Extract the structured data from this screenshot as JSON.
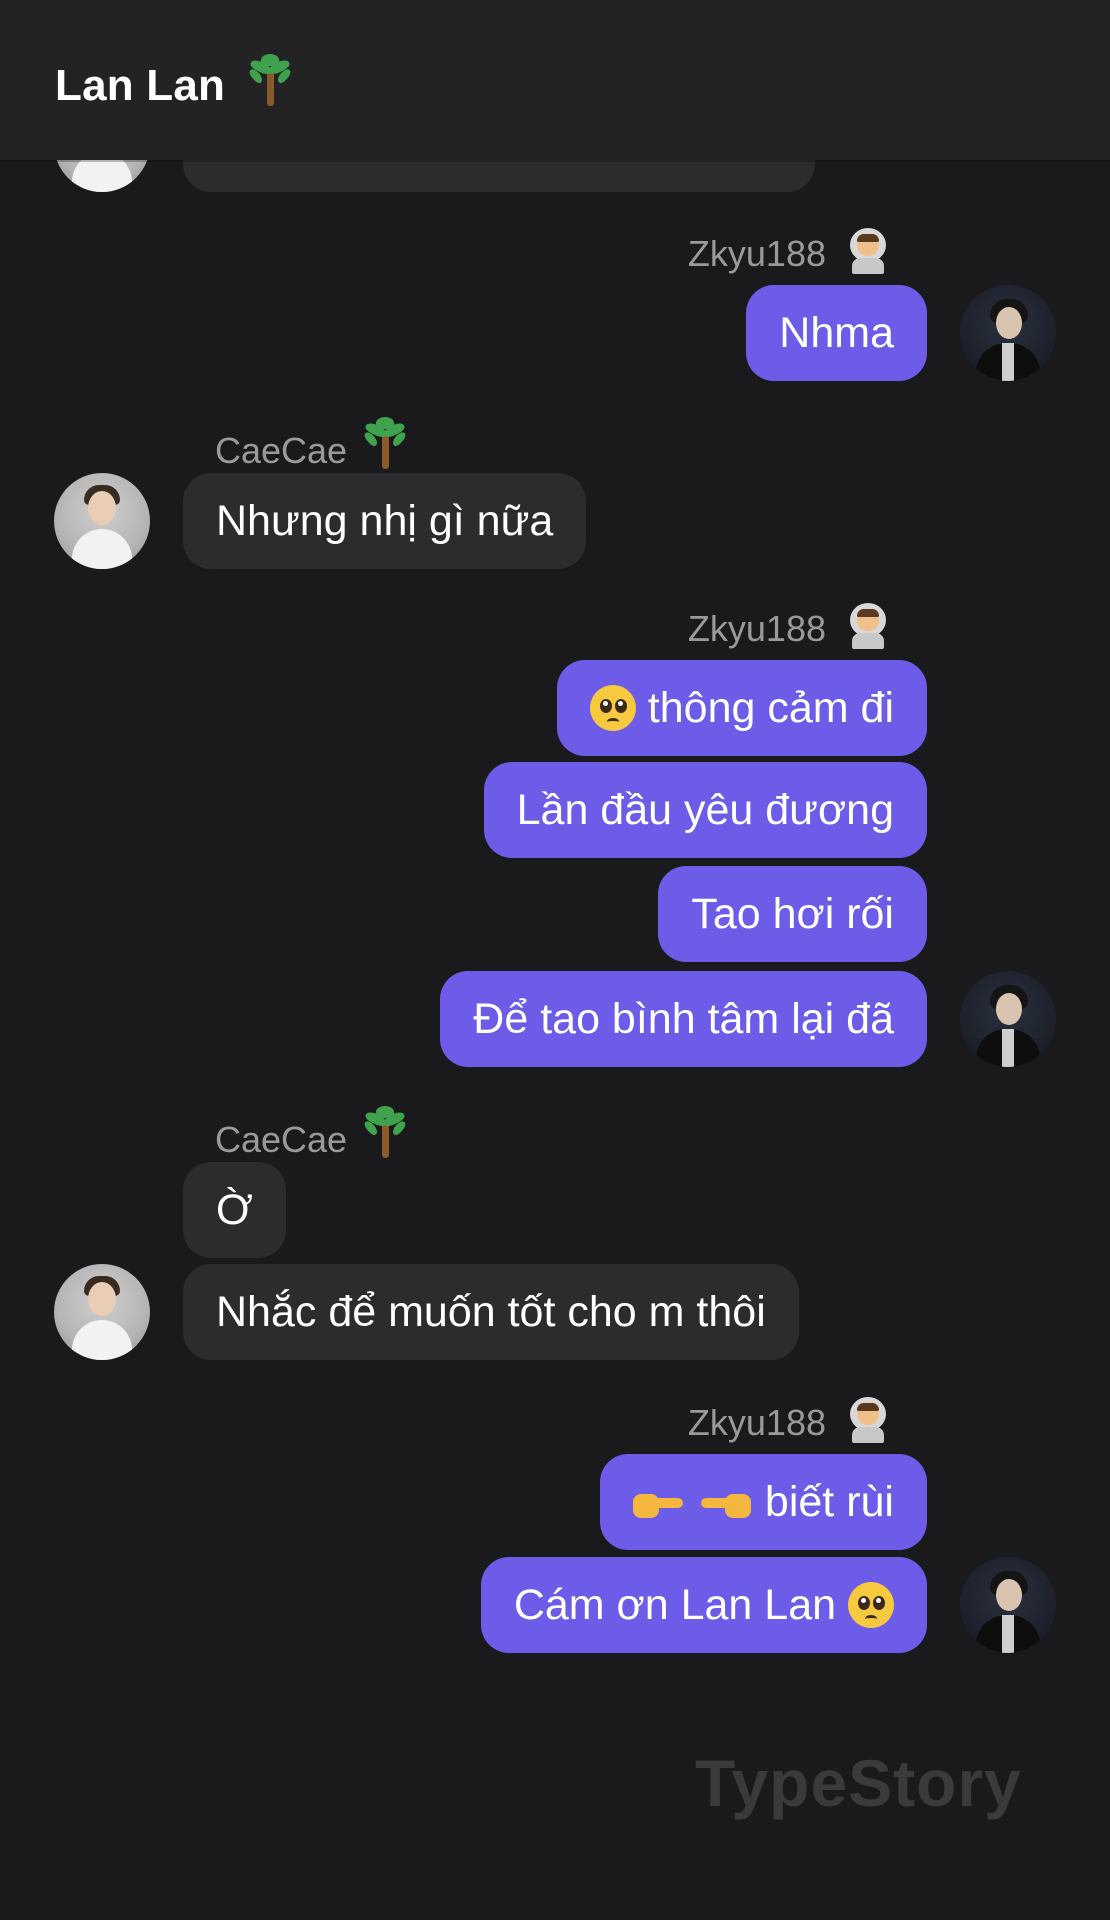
{
  "header": {
    "title": "Lan Lan",
    "title_icon": "palm-tree-icon"
  },
  "messages": {
    "top_partial_text": "...",
    "zkyu_name": "Zkyu188",
    "caecae_name": "CaeCae",
    "g1": {
      "m1": "Nhma"
    },
    "g2": {
      "m1": "Nhưng nhị gì nữa"
    },
    "g3": {
      "m1": "thông cảm đi",
      "m2": "Lần đầu yêu đương",
      "m3": "Tao hơi rối",
      "m4": "Để tao bình tâm lại đã"
    },
    "g4": {
      "m1": "Ờ",
      "m2": "Nhắc để muốn tốt cho m thôi"
    },
    "g5": {
      "m1": "biết rùi",
      "m2": "Cám ơn Lan Lan"
    }
  },
  "watermark": "TypeStory",
  "colors": {
    "background": "#1a1a1c",
    "header": "#232325",
    "incoming_bubble": "#2c2c2e",
    "outgoing_bubble": "#6c5ce7",
    "sender_label": "#9a9a9e"
  }
}
